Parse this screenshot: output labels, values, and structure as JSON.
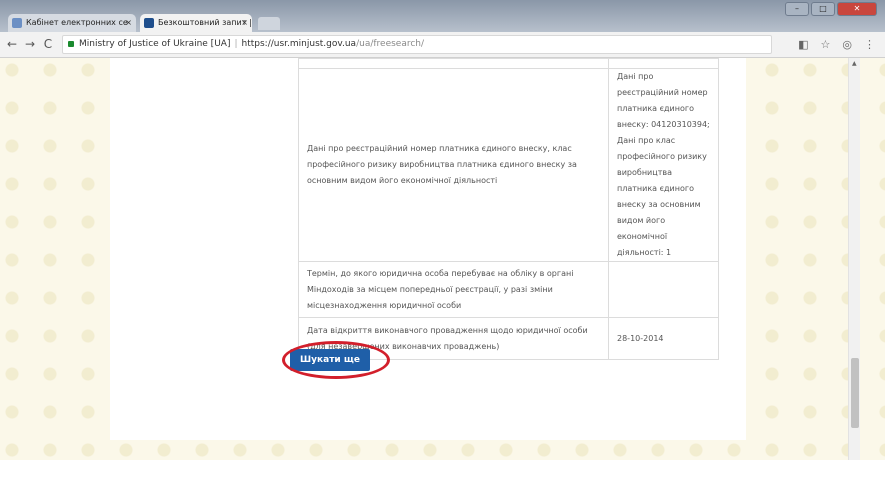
{
  "browser": {
    "tabs": [
      {
        "label": "Кабінет електронних се"
      },
      {
        "label": "Безкоштовний запит | М"
      }
    ],
    "tab_close": "×",
    "url_site": "Ministry of Justice of Ukraine [UA]",
    "url_scheme_host": "https://usr.minjust.gov.ua",
    "url_path": "/ua/freesearch/",
    "nav": {
      "back": "←",
      "forward": "→",
      "reload": "C"
    },
    "right_icons": {
      "translate": "◧",
      "star": "☆",
      "ext": "◎",
      "menu": "⋮"
    },
    "win": {
      "minimize": "–",
      "maximize": "□",
      "close": "✕"
    },
    "scroll_up": "▲"
  },
  "table": {
    "rows": [
      {
        "label": "Дані про реєстраційний номер платника єдиного внеску, клас професійного ризику виробництва платника єдиного внеску за основним видом його економічної діяльності",
        "value": "Дані про реєстраційний номер платника єдиного внеску: 04120310394; Дані про клас професійного ризику виробництва платника єдиного внеску за основним видом його економічної діяльності: 1"
      },
      {
        "label": "Термін, до якого юридична особа перебуває на обліку в органі Міндоходів за місцем попередньої реєстрації, у разі зміни місцезнаходження юридичної особи",
        "value": ""
      },
      {
        "label": "Дата відкриття виконавчого провадження щодо юридичної особи (для незавершених виконавчих проваджень)",
        "value": "28-10-2014"
      }
    ]
  },
  "search_again_label": "Шукати ще",
  "colors": {
    "button": "#1f5fa8",
    "highlight": "#d21f2b",
    "background": "#fbf8e9"
  }
}
